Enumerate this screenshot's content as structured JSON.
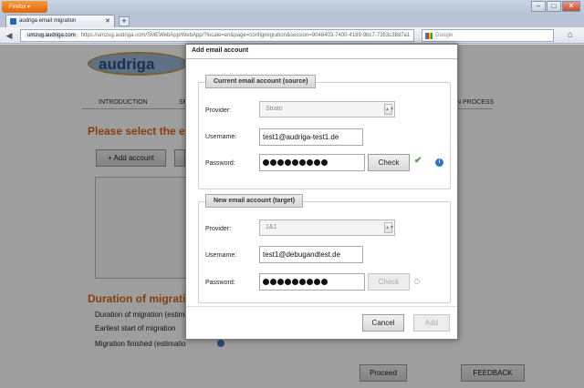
{
  "browser": {
    "app_button": "Firefox",
    "tab_title": "audriga email migration",
    "url_domain": "umzug.audriga.com",
    "url_rest": "https://umzug.audriga.com/SMEWebApp/WebApp/?locale=en&page=configmigration&session=9048403-7400-4189-9bc7-7353c38d7a1",
    "search_placeholder": "Google",
    "new_tab_symbol": "+"
  },
  "page": {
    "logo_text": "audriga",
    "nav": {
      "introduction": "INTRODUCTION",
      "step2_partial": "SE",
      "process_partial": "N PROCESS"
    },
    "heading_select": "Please select the em",
    "add_account_button": "+ Add account",
    "heading_duration": "Duration of migratio",
    "duration_rows": [
      "Duration of migration (estima",
      "Earliest start of migration",
      "Migration finished (estimatio"
    ],
    "proceed_button": "Proceed",
    "feedback_button": "FEEDBACK"
  },
  "modal": {
    "title": "Add email account",
    "source": {
      "legend": "Current email account (source)",
      "provider_label": "Provider:",
      "provider_value": "Strato",
      "username_label": "Username:",
      "username_value": "test1@audriga-test1.de",
      "password_label": "Password:",
      "password_dots": 9,
      "check_label": "Check",
      "status_icon": "check-mark-icon"
    },
    "target": {
      "legend": "New email account (target)",
      "provider_label": "Provider:",
      "provider_value": "1&1",
      "username_label": "Username:",
      "username_value": "test1@debugandtest.de",
      "password_label": "Password:",
      "password_dots": 9,
      "check_label": "Check",
      "status_icon": "loading-icon"
    },
    "cancel_label": "Cancel",
    "add_label": "Add"
  },
  "colors": {
    "accent_orange": "#d9651a",
    "ok_green": "#46a437",
    "info_blue": "#2f6fce"
  }
}
